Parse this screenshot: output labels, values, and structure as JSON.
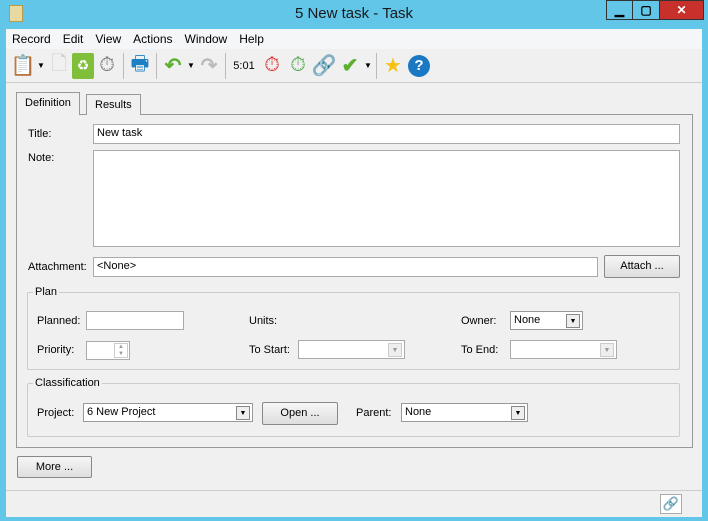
{
  "window": {
    "title": "5 New task - Task",
    "minimize": "▁",
    "maximize": "▢",
    "close": "✕",
    "close_color": "#c7302b",
    "frame_color": "#62c6e8"
  },
  "menu": [
    "Record",
    "Edit",
    "View",
    "Actions",
    "Window",
    "Help"
  ],
  "toolbar": {
    "timer": "5:01",
    "icons": [
      "new-task-icon",
      "new-document-icon",
      "recycle-bin-icon",
      "stopwatch-add-icon",
      "print-icon",
      "undo-icon",
      "redo-icon",
      "stopwatch-stop-icon",
      "stopwatch-start-icon",
      "link-icon",
      "check-icon",
      "star-icon",
      "help-icon"
    ]
  },
  "tabs": [
    {
      "label": "Definition",
      "active": true
    },
    {
      "label": "Results",
      "active": false
    }
  ],
  "form": {
    "title_label": "Title:",
    "title_value": "New task",
    "note_label": "Note:",
    "note_value": "",
    "attachment_label": "Attachment:",
    "attachment_value": "<None>",
    "attach_button": "Attach ...",
    "plan": {
      "legend": "Plan",
      "planned_label": "Planned:",
      "planned_value": "",
      "units_label": "Units:",
      "owner_label": "Owner:",
      "owner_value": "None",
      "priority_label": "Priority:",
      "priority_value": "",
      "to_start_label": "To Start:",
      "to_start_value": "",
      "to_end_label": "To End:",
      "to_end_value": ""
    },
    "classification": {
      "legend": "Classification",
      "project_label": "Project:",
      "project_value": "6 New Project",
      "open_button": "Open ...",
      "parent_label": "Parent:",
      "parent_value": "None"
    }
  },
  "more_button": "More ..."
}
